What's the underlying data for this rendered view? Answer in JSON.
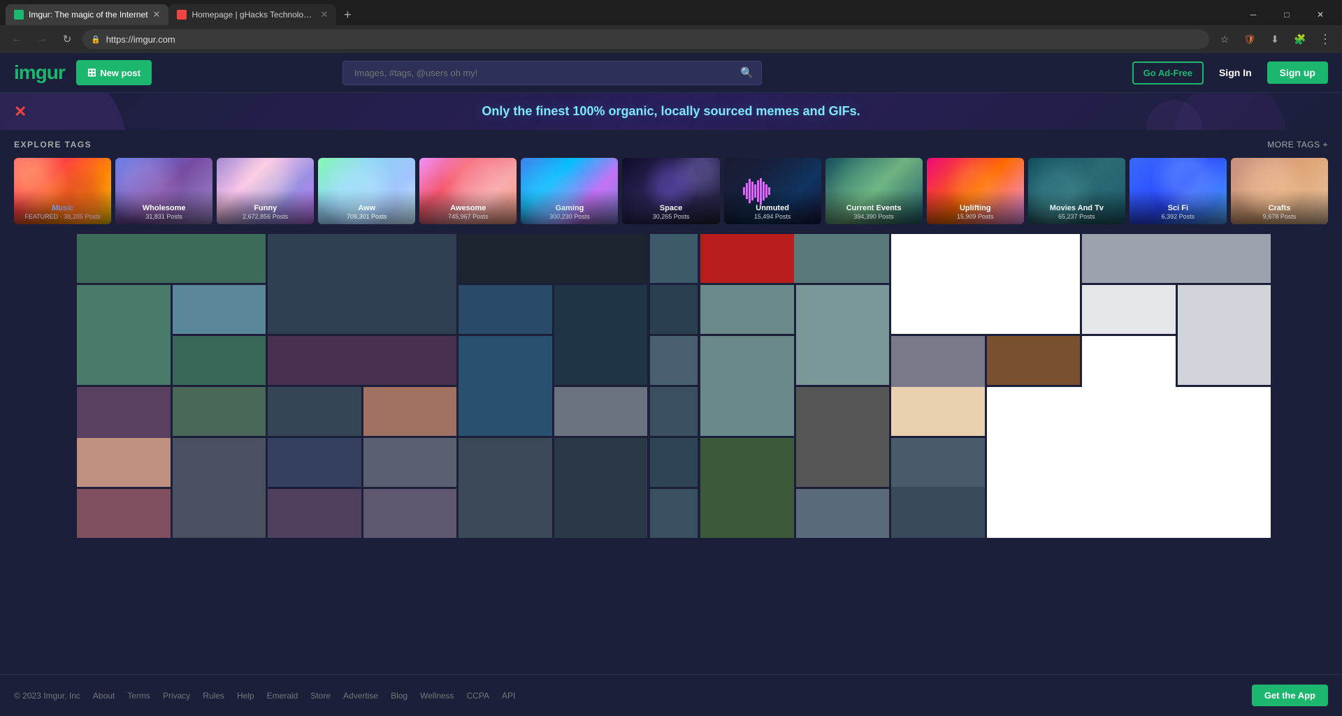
{
  "browser": {
    "tabs": [
      {
        "id": "tab1",
        "title": "Imgur: The magic of the Internet",
        "url": "https://imgur.com",
        "active": true,
        "favicon_color": "#1bb76e"
      },
      {
        "id": "tab2",
        "title": "Homepage | gHacks Technology News",
        "url": "https://ghacks.net",
        "active": false,
        "favicon_color": "#e44"
      }
    ],
    "address": "https://imgur.com",
    "new_tab_label": "+"
  },
  "header": {
    "logo": "imgur",
    "new_post_label": "New post",
    "search_placeholder": "Images, #tags, @users oh my!",
    "go_adfree_label": "Go Ad-Free",
    "sign_in_label": "Sign In",
    "sign_up_label": "Sign up"
  },
  "hero": {
    "tagline": "Only the finest 100% organic, locally sourced memes and GIFs.",
    "close_label": "×"
  },
  "explore_tags": {
    "title": "EXPLORE TAGS",
    "more_tags_label": "MORE TAGS +",
    "tags": [
      {
        "id": "music",
        "name": "Music",
        "badge": "FEATURED",
        "posts": "38,285 Posts",
        "css_class": "tag-music"
      },
      {
        "id": "wholesome",
        "name": "Wholesome",
        "badge": "",
        "posts": "31,831 Posts",
        "css_class": "tag-wholesome"
      },
      {
        "id": "funny",
        "name": "Funny",
        "badge": "",
        "posts": "2,672,856 Posts",
        "css_class": "tag-funny"
      },
      {
        "id": "aww",
        "name": "Aww",
        "badge": "",
        "posts": "709,301 Posts",
        "css_class": "tag-aww"
      },
      {
        "id": "awesome",
        "name": "Awesome",
        "badge": "",
        "posts": "745,967 Posts",
        "css_class": "tag-awesome"
      },
      {
        "id": "gaming",
        "name": "Gaming",
        "badge": "",
        "posts": "300,230 Posts",
        "css_class": "tag-gaming"
      },
      {
        "id": "space",
        "name": "Space",
        "badge": "",
        "posts": "30,265 Posts",
        "css_class": "tag-space"
      },
      {
        "id": "unmuted",
        "name": "Unmuted",
        "badge": "",
        "posts": "15,494 Posts",
        "css_class": "tag-unmuted"
      },
      {
        "id": "current_events",
        "name": "Current Events",
        "badge": "",
        "posts": "394,390 Posts",
        "css_class": "tag-current"
      },
      {
        "id": "uplifting",
        "name": "Uplifting",
        "badge": "",
        "posts": "15,909 Posts",
        "css_class": "tag-uplifting"
      },
      {
        "id": "movies_tv",
        "name": "Movies And Tv",
        "badge": "",
        "posts": "65,237 Posts",
        "css_class": "tag-movies"
      },
      {
        "id": "scifi",
        "name": "Sci Fi",
        "badge": "",
        "posts": "6,392 Posts",
        "css_class": "tag-scifi"
      },
      {
        "id": "crafts",
        "name": "Crafts",
        "badge": "",
        "posts": "9,678 Posts",
        "css_class": "tag-crafts"
      }
    ]
  },
  "footer": {
    "copyright": "© 2023 Imgur, Inc",
    "links": [
      "About",
      "Terms",
      "Privacy",
      "Rules",
      "Help",
      "Emerald",
      "Store",
      "Advertise",
      "Blog",
      "Wellness",
      "CCPA",
      "API"
    ],
    "get_app_label": "Get the App"
  }
}
